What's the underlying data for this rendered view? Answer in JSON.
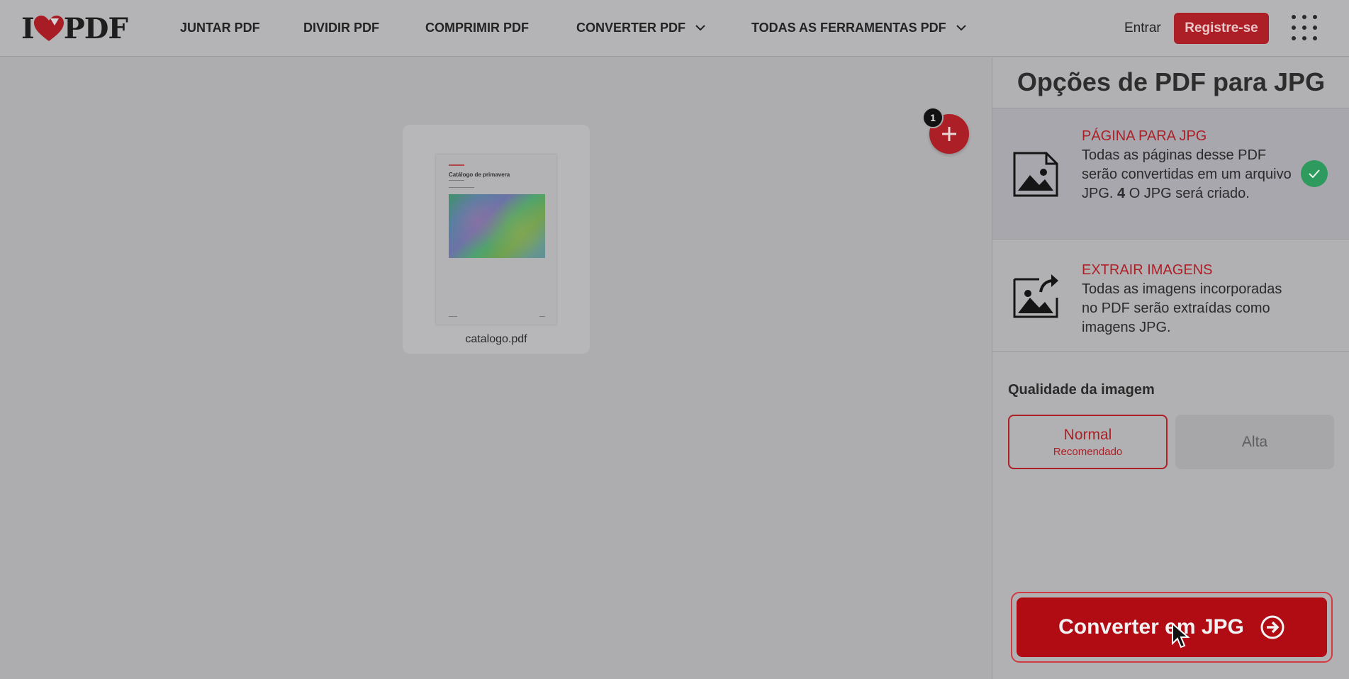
{
  "header": {
    "logo": {
      "left": "I",
      "right": "PDF"
    },
    "nav": [
      {
        "label": "JUNTAR PDF",
        "has_dropdown": false
      },
      {
        "label": "DIVIDIR PDF",
        "has_dropdown": false
      },
      {
        "label": "COMPRIMIR PDF",
        "has_dropdown": false
      },
      {
        "label": "CONVERTER PDF",
        "has_dropdown": true
      },
      {
        "label": "TODAS AS FERRAMENTAS PDF",
        "has_dropdown": true
      }
    ],
    "login_label": "Entrar",
    "signup_label": "Registre-se",
    "apps_icon": "grid-apps-icon"
  },
  "workspace": {
    "file": {
      "name": "catalogo.pdf",
      "preview_title": "Catálogo de primavera"
    },
    "file_count_badge": "1",
    "add_icon": "plus-icon"
  },
  "sidebar": {
    "title": "Opções de PDF para JPG",
    "options": [
      {
        "heading": "PÁGINA PARA JPG",
        "desc_before": "Todas as páginas desse PDF serão convertidas em um arquivo JPG. ",
        "desc_count": "4",
        "desc_after": " O JPG será criado.",
        "selected": true,
        "icon": "image-file-icon"
      },
      {
        "heading": "EXTRAIR IMAGENS",
        "desc": "Todas as imagens incorporadas no PDF serão extraídas como imagens JPG.",
        "selected": false,
        "icon": "extract-image-icon"
      }
    ],
    "quality": {
      "label": "Qualidade da imagem",
      "normal": "Normal",
      "normal_sub": "Recomendado",
      "high": "Alta",
      "selected": "Normal"
    },
    "convert_label": "Converter em JPG"
  },
  "colors": {
    "brand_red": "#ad1f27",
    "success_green": "#2f9a5d",
    "overlay_gray": "#adadaf"
  }
}
